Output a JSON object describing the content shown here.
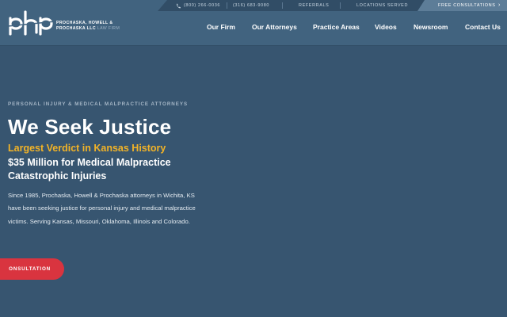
{
  "topbar": {
    "phone1": "(800) 266-0036",
    "phone2": "(316) 683-9080",
    "referrals": "REFERRALS",
    "locations": "LOCATIONS SERVED",
    "free_consult": "FREE CONSULTATIONS"
  },
  "brand": {
    "logo_text": "php",
    "name_line1": "PROCHASKA, HOWELL &",
    "name_line2": "PROCHASKA LLC",
    "name_suffix": "LAW FIRM"
  },
  "nav": {
    "items": [
      "Our Firm",
      "Our Attorneys",
      "Practice Areas",
      "Videos",
      "Newsroom",
      "Contact Us"
    ]
  },
  "hero": {
    "eyebrow": "PERSONAL INJURY & MEDICAL MALPRACTICE ATTORNEYS",
    "headline": "We Seek Justice",
    "verdict": "Largest Verdict in Kansas History",
    "million": "$35 Million for Medical Malpractice Catastrophic Injuries",
    "body": "Since 1985, Prochaska, Howell & Prochaska attorneys in Wichita, KS have been seeking justice for personal injury and medical malpractice victims. Serving Kansas, Missouri, Oklahoma, Illinois and Colorado.",
    "cta": "ONSULTATION"
  },
  "colors": {
    "background": "#375570",
    "header": "#41637f",
    "accent_yellow": "#f2b327",
    "cta_red": "#d9343f"
  }
}
